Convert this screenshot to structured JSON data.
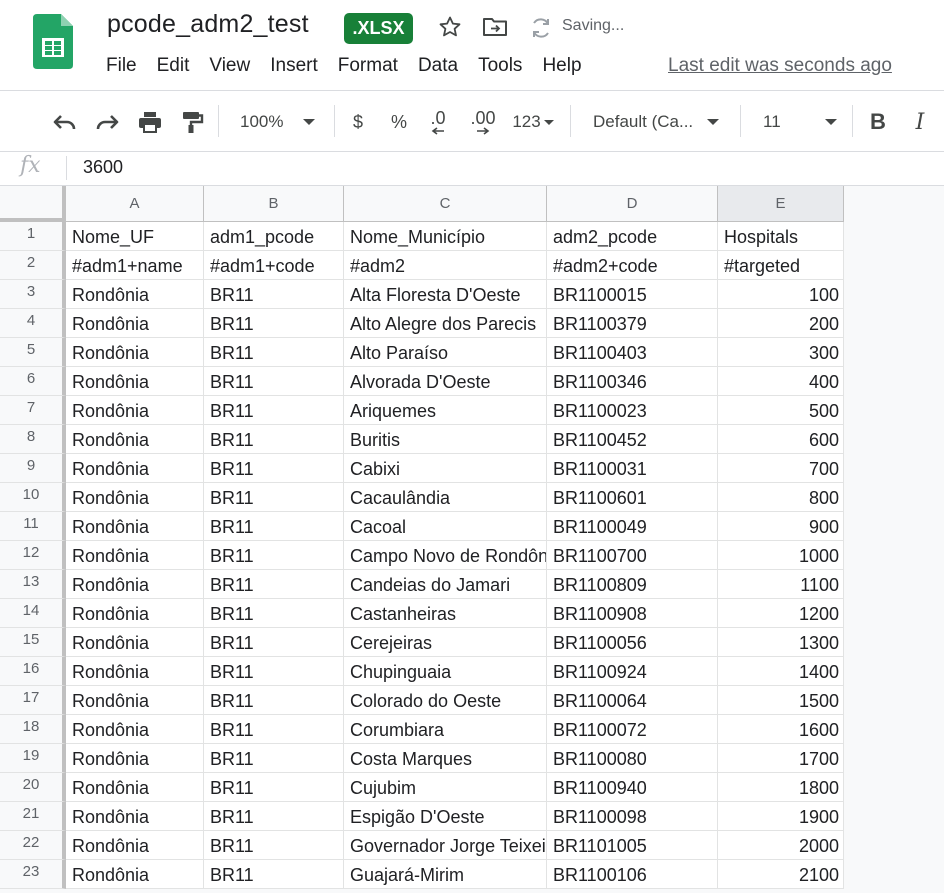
{
  "header": {
    "title": "pcode_adm2_test",
    "badge": ".XLSX",
    "saving": "Saving...",
    "last_edit": "Last edit was seconds ago",
    "menu": [
      "File",
      "Edit",
      "View",
      "Insert",
      "Format",
      "Data",
      "Tools",
      "Help"
    ]
  },
  "toolbar": {
    "zoom": "100%",
    "currency": "$",
    "percent": "%",
    "dec_decrease": ".0",
    "dec_increase": ".00",
    "more_formats": "123",
    "font": "Default (Ca...",
    "font_size": "11",
    "bold": "B",
    "italic": "I"
  },
  "formula_bar": {
    "fx": "fx",
    "value": "3600"
  },
  "grid": {
    "columns": [
      "A",
      "B",
      "C",
      "D",
      "E"
    ],
    "selected_column": "E",
    "rows": [
      {
        "n": "1",
        "a": "Nome_UF",
        "b": "adm1_pcode",
        "c": "Nome_Município",
        "d": "adm2_pcode",
        "e": "Hospitals"
      },
      {
        "n": "2",
        "a": "#adm1+name",
        "b": "#adm1+code",
        "c": "#adm2",
        "d": "#adm2+code",
        "e": "#targeted"
      },
      {
        "n": "3",
        "a": "Rondônia",
        "b": "BR11",
        "c": "Alta Floresta D'Oeste",
        "d": "BR1100015",
        "e": "100"
      },
      {
        "n": "4",
        "a": "Rondônia",
        "b": "BR11",
        "c": "Alto Alegre dos Parecis",
        "d": "BR1100379",
        "e": "200"
      },
      {
        "n": "5",
        "a": "Rondônia",
        "b": "BR11",
        "c": "Alto Paraíso",
        "d": "BR1100403",
        "e": "300"
      },
      {
        "n": "6",
        "a": "Rondônia",
        "b": "BR11",
        "c": "Alvorada D'Oeste",
        "d": "BR1100346",
        "e": "400"
      },
      {
        "n": "7",
        "a": "Rondônia",
        "b": "BR11",
        "c": "Ariquemes",
        "d": "BR1100023",
        "e": "500"
      },
      {
        "n": "8",
        "a": "Rondônia",
        "b": "BR11",
        "c": "Buritis",
        "d": "BR1100452",
        "e": "600"
      },
      {
        "n": "9",
        "a": "Rondônia",
        "b": "BR11",
        "c": "Cabixi",
        "d": "BR1100031",
        "e": "700"
      },
      {
        "n": "10",
        "a": "Rondônia",
        "b": "BR11",
        "c": "Cacaulândia",
        "d": "BR1100601",
        "e": "800"
      },
      {
        "n": "11",
        "a": "Rondônia",
        "b": "BR11",
        "c": "Cacoal",
        "d": "BR1100049",
        "e": "900"
      },
      {
        "n": "12",
        "a": "Rondônia",
        "b": "BR11",
        "c": "Campo Novo de Rondônia",
        "d": "BR1100700",
        "e": "1000"
      },
      {
        "n": "13",
        "a": "Rondônia",
        "b": "BR11",
        "c": "Candeias do Jamari",
        "d": "BR1100809",
        "e": "1100"
      },
      {
        "n": "14",
        "a": "Rondônia",
        "b": "BR11",
        "c": "Castanheiras",
        "d": "BR1100908",
        "e": "1200"
      },
      {
        "n": "15",
        "a": "Rondônia",
        "b": "BR11",
        "c": "Cerejeiras",
        "d": "BR1100056",
        "e": "1300"
      },
      {
        "n": "16",
        "a": "Rondônia",
        "b": "BR11",
        "c": "Chupinguaia",
        "d": "BR1100924",
        "e": "1400"
      },
      {
        "n": "17",
        "a": "Rondônia",
        "b": "BR11",
        "c": "Colorado do Oeste",
        "d": "BR1100064",
        "e": "1500"
      },
      {
        "n": "18",
        "a": "Rondônia",
        "b": "BR11",
        "c": "Corumbiara",
        "d": "BR1100072",
        "e": "1600"
      },
      {
        "n": "19",
        "a": "Rondônia",
        "b": "BR11",
        "c": "Costa Marques",
        "d": "BR1100080",
        "e": "1700"
      },
      {
        "n": "20",
        "a": "Rondônia",
        "b": "BR11",
        "c": "Cujubim",
        "d": "BR1100940",
        "e": "1800"
      },
      {
        "n": "21",
        "a": "Rondônia",
        "b": "BR11",
        "c": "Espigão D'Oeste",
        "d": "BR1100098",
        "e": "1900"
      },
      {
        "n": "22",
        "a": "Rondônia",
        "b": "BR11",
        "c": "Governador Jorge Teixeira",
        "d": "BR1101005",
        "e": "2000"
      },
      {
        "n": "23",
        "a": "Rondônia",
        "b": "BR11",
        "c": "Guajará-Mirim",
        "d": "BR1100106",
        "e": "2100"
      }
    ]
  },
  "colors": {
    "brand_green": "#188038",
    "sheets_green": "#23a566",
    "grid_line": "#e2e3e3",
    "header_bg": "#f8f9fa"
  }
}
